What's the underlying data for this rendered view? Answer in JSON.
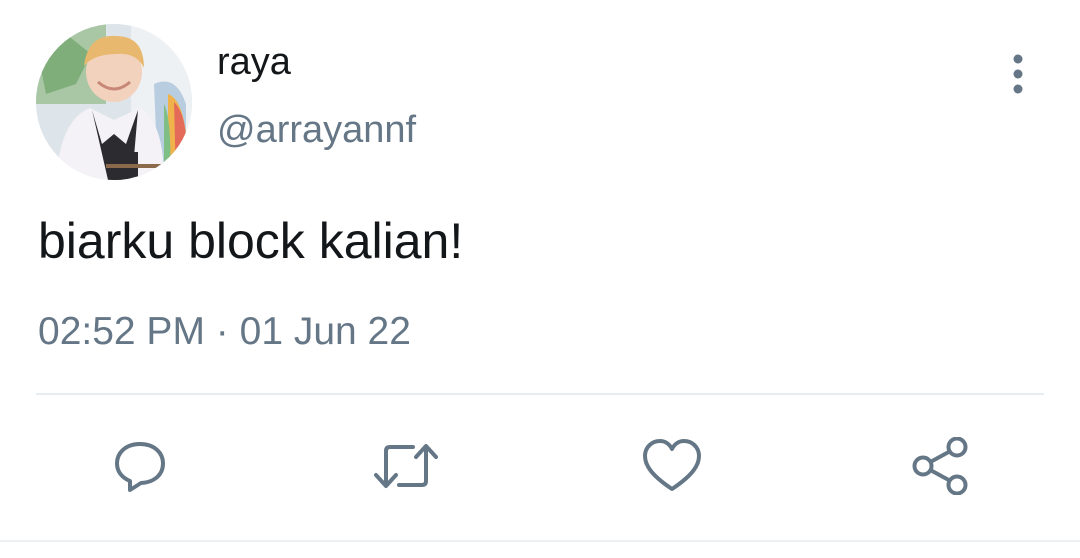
{
  "user": {
    "display_name": "raya",
    "handle": "@arrayannf",
    "avatar_icon": "profile-photo"
  },
  "tweet": {
    "text": "biarku block kalian!",
    "time": "02:52 PM",
    "separator": "·",
    "date": "01 Jun 22"
  },
  "actions": [
    {
      "name": "reply",
      "icon": "speech-bubble-icon"
    },
    {
      "name": "retweet",
      "icon": "retweet-icon"
    },
    {
      "name": "like",
      "icon": "heart-icon"
    },
    {
      "name": "share",
      "icon": "share-icon"
    }
  ],
  "colors": {
    "primary_text": "#14171a",
    "secondary_text": "#657786",
    "icon": "#657786",
    "divider": "#e6ecf0"
  }
}
